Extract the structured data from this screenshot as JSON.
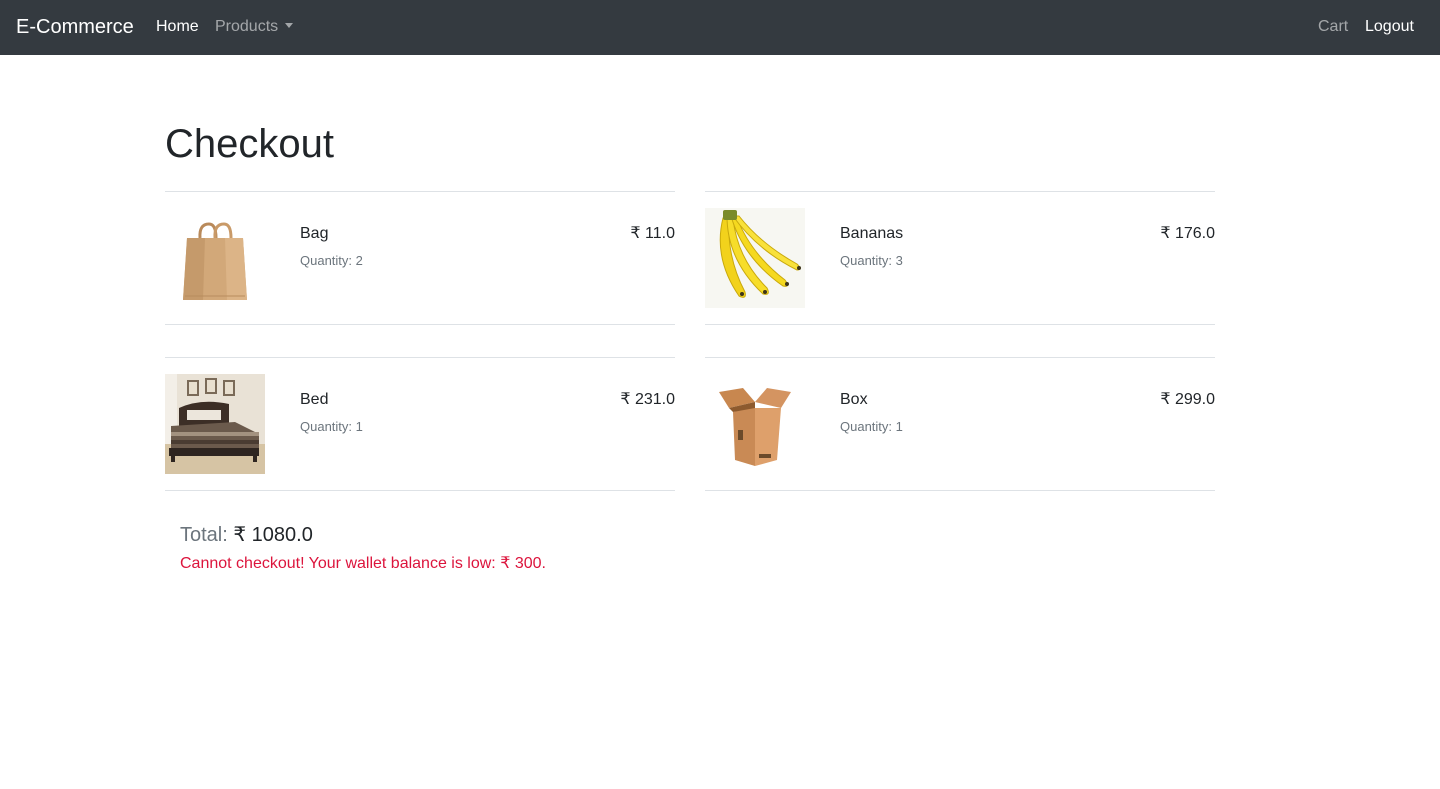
{
  "navbar": {
    "brand": "E-Commerce",
    "home": "Home",
    "products": "Products",
    "cart": "Cart",
    "logout": "Logout",
    "bg_color": "#343a40"
  },
  "page": {
    "title": "Checkout"
  },
  "items": [
    {
      "name": "Bag",
      "quantity": "Quantity: 2",
      "price": "₹ 11.0",
      "icon": "paper-bag-image"
    },
    {
      "name": "Bananas",
      "quantity": "Quantity: 3",
      "price": "₹ 176.0",
      "icon": "bananas-image"
    },
    {
      "name": "Bed",
      "quantity": "Quantity: 1",
      "price": "₹ 231.0",
      "icon": "bed-image"
    },
    {
      "name": "Box",
      "quantity": "Quantity: 1",
      "price": "₹ 299.0",
      "icon": "cardboard-box-image"
    }
  ],
  "summary": {
    "total_label": "Total:",
    "total_value": "₹ 1080.0",
    "warning": "Cannot checkout! Your wallet balance is low: ₹ 300.",
    "warning_color": "#dc143c"
  }
}
